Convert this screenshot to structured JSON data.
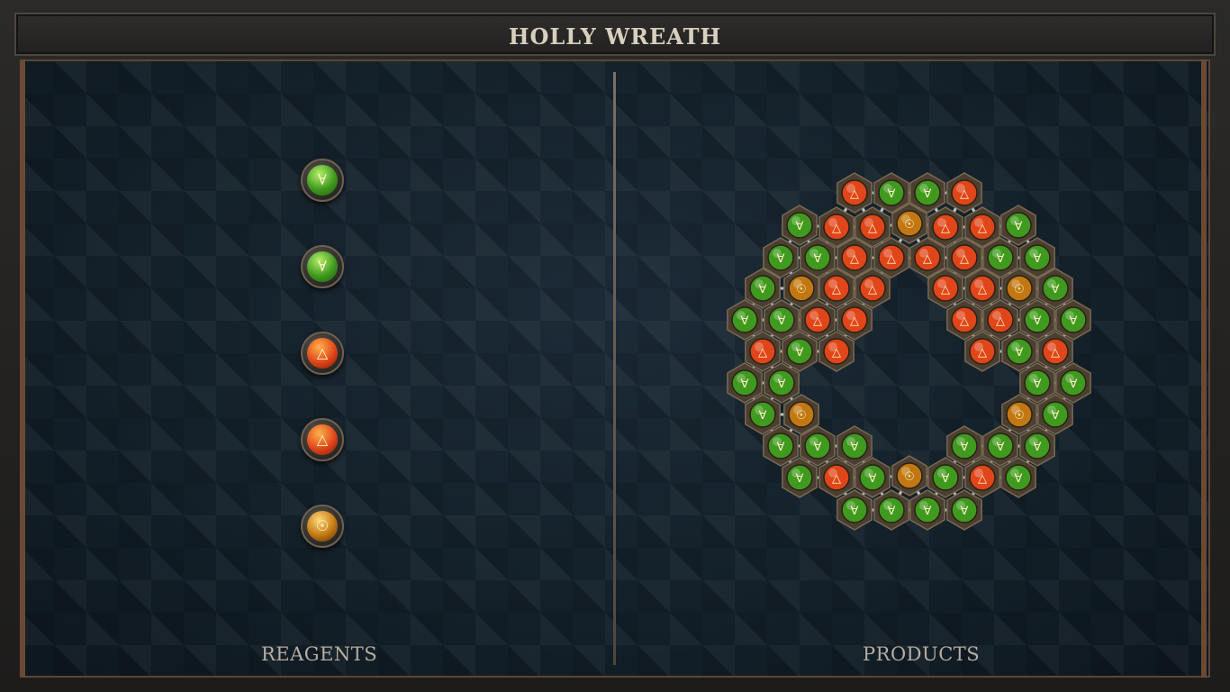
{
  "title": "HOLLY WREATH",
  "reagents_label": "REAGENTS",
  "products_label": "PRODUCTS",
  "reagents": [
    {
      "element": "green",
      "symbol": "∀"
    },
    {
      "element": "green",
      "symbol": "∀"
    },
    {
      "element": "red",
      "symbol": "△"
    },
    {
      "element": "red",
      "symbol": "△"
    },
    {
      "element": "gold",
      "symbol": "☉"
    }
  ],
  "element_symbols": {
    "green": "∀",
    "red": "△",
    "gold": "☉"
  },
  "colors": {
    "green": "#3f9a1f",
    "red": "#e0461a",
    "gold": "#c27812",
    "bond": "#b9c6c9",
    "tile": "#4b3f30"
  }
}
